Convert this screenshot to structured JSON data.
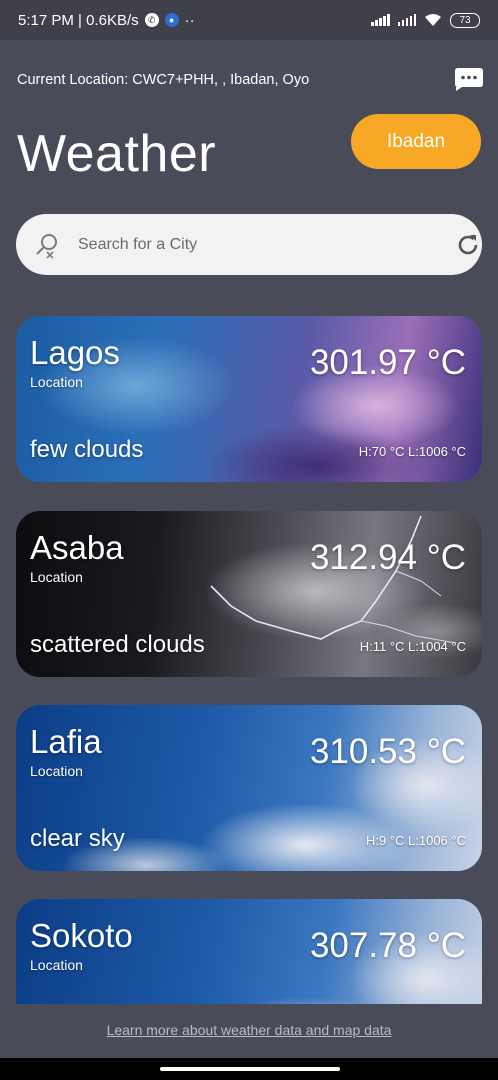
{
  "status_bar": {
    "time_speed": "5:17 PM | 0.6KB/s",
    "more": "··",
    "battery": "73"
  },
  "header": {
    "current_location": "Current Location: CWC7+PHH, , Ibadan, Oyo",
    "title": "Weather",
    "city_button": "Ibadan"
  },
  "search": {
    "placeholder": "Search for a City"
  },
  "cards": [
    {
      "city": "Lagos",
      "sub": "Location",
      "temp": "301.97 °C",
      "desc": "few clouds",
      "hl": "H:70 °C L:1006 °C"
    },
    {
      "city": "Asaba",
      "sub": "Location",
      "temp": "312.94 °C",
      "desc": "scattered clouds",
      "hl": "H:11 °C L:1004 °C"
    },
    {
      "city": "Lafia",
      "sub": "Location",
      "temp": "310.53 °C",
      "desc": "clear sky",
      "hl": "H:9 °C L:1006 °C"
    },
    {
      "city": "Sokoto",
      "sub": "Location",
      "temp": "307.78 °C",
      "desc": "",
      "hl": ""
    }
  ],
  "footer": {
    "link": "Learn more about weather data and map data"
  },
  "colors": {
    "background": "#4a4b58",
    "accent": "#f7a825",
    "search_bg": "#f2f2f2"
  },
  "icons": {
    "chat": "chat-bubble-icon",
    "search": "search-icon",
    "refresh": "refresh-icon"
  }
}
